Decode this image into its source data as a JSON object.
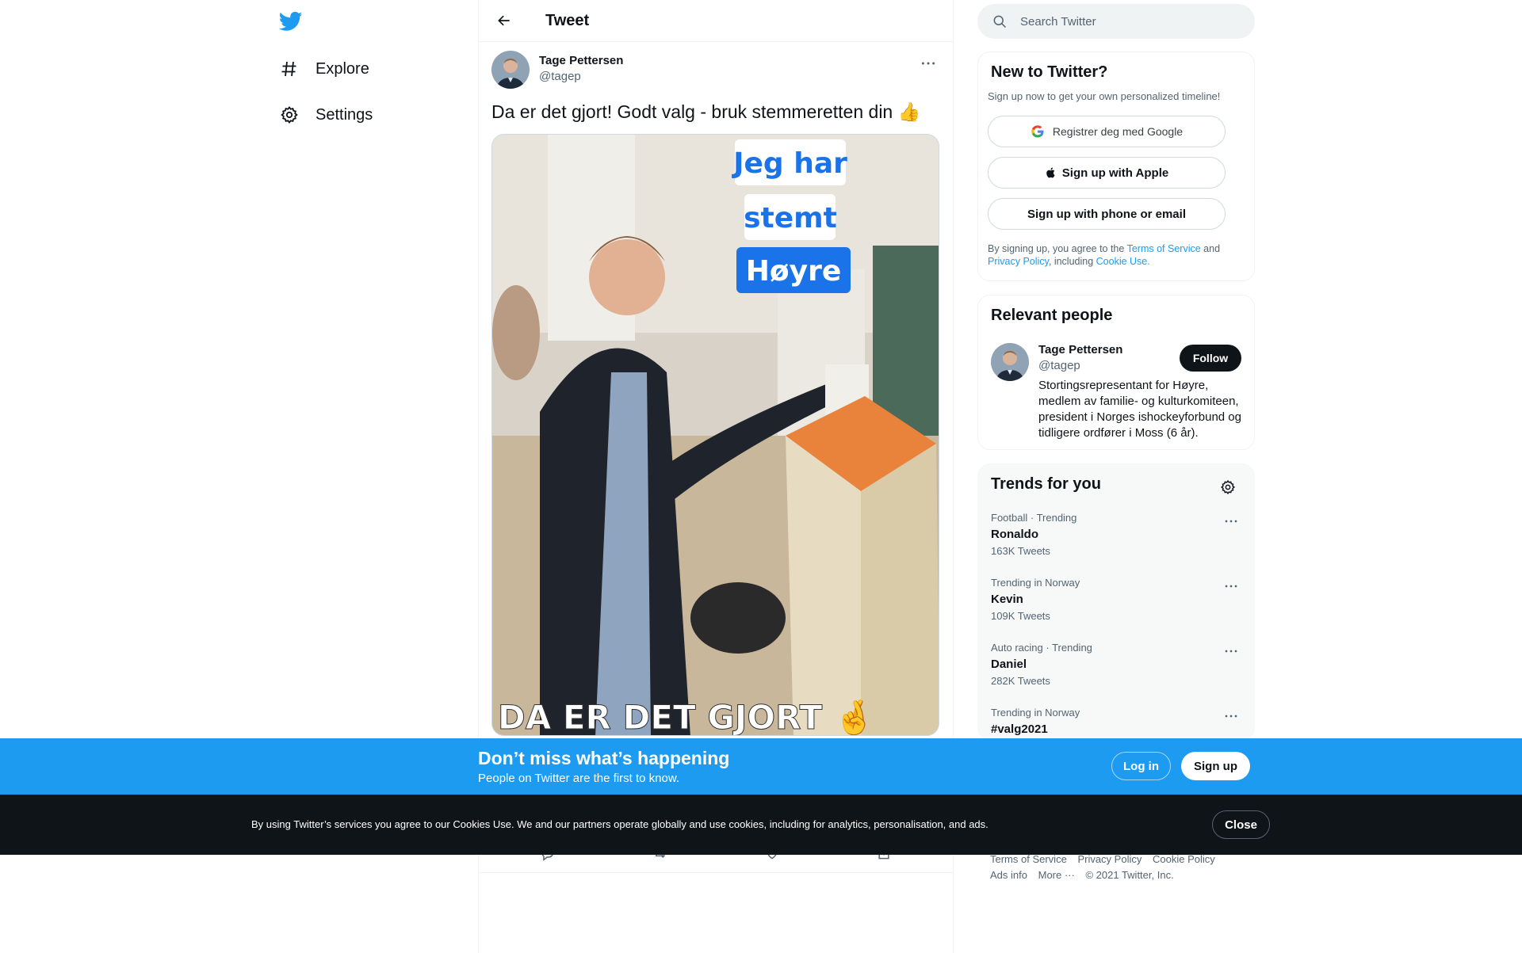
{
  "header": {
    "title": "Tweet"
  },
  "nav": {
    "items": [
      {
        "label": "Explore",
        "icon": "hashtag-icon"
      },
      {
        "label": "Settings",
        "icon": "gear-icon"
      }
    ]
  },
  "tweet": {
    "author_name": "Tage Pettersen",
    "author_handle": "@tagep",
    "text": "Da er det gjort! Godt valg - bruk stemmeretten din 👍",
    "media": {
      "overlay_lines": [
        "Jeg har",
        "stemt",
        "Høyre"
      ],
      "caption": "DA ER DET GJORT 🤞"
    }
  },
  "search": {
    "placeholder": "Search Twitter"
  },
  "signup": {
    "title": "New to Twitter?",
    "subtitle": "Sign up now to get your own personalized timeline!",
    "google_label": "Registrer deg med Google",
    "apple_label": "Sign up with Apple",
    "phone_label": "Sign up with phone or email",
    "legal_prefix": "By signing up, you agree to the ",
    "terms_link": "Terms of Service",
    "legal_and": " and ",
    "privacy_link": "Privacy Policy",
    "legal_including": ", including ",
    "cookie_link": "Cookie Use."
  },
  "relevant_people": {
    "title": "Relevant people",
    "name": "Tage Pettersen",
    "handle": "@tagep",
    "follow_label": "Follow",
    "bio": "Stortingsrepresentant for Høyre, medlem av familie- og kulturkomiteen, president i Norges ishockeyforbund og tidligere ordfører i Moss (6 år)."
  },
  "trends": {
    "title": "Trends for you",
    "items": [
      {
        "meta": "Football · Trending",
        "name": "Ronaldo",
        "count": "163K Tweets"
      },
      {
        "meta": "Trending in Norway",
        "name": "Kevin",
        "count": "109K Tweets"
      },
      {
        "meta": "Auto racing · Trending",
        "name": "Daniel",
        "count": "282K Tweets"
      },
      {
        "meta": "Trending in Norway",
        "name": "#valg2021",
        "count": ""
      }
    ]
  },
  "footer": {
    "links": [
      "Terms of Service",
      "Privacy Policy",
      "Cookie Policy",
      "Ads info",
      "More ···"
    ],
    "copyright": "© 2021 Twitter, Inc."
  },
  "banner": {
    "title": "Don’t miss what’s happening",
    "subtitle": "People on Twitter are the first to know.",
    "login_label": "Log in",
    "signup_label": "Sign up"
  },
  "cookie_bar": {
    "text": "By using Twitter’s services you agree to our Cookies Use. We and our partners operate globally and use cookies, including for analytics, personalisation, and ads.",
    "close_label": "Close"
  },
  "colors": {
    "brand": "#1d9bf0",
    "text": "#0f1419",
    "muted": "#536471",
    "cookie_bg": "#0f1419"
  }
}
